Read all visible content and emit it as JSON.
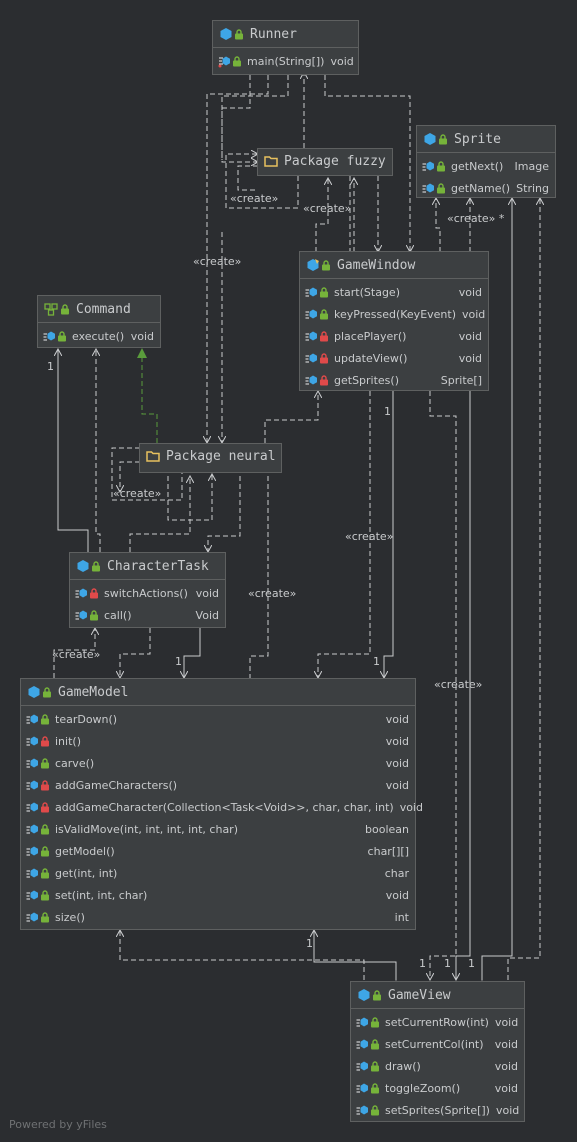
{
  "diagram": {
    "footer": "Powered by yFiles",
    "nodes": {
      "runner": {
        "title": "Runner",
        "kind": "class",
        "members": [
          {
            "name": "main(String[])",
            "type": "void",
            "access": "public",
            "static": true
          }
        ]
      },
      "sprite": {
        "title": "Sprite",
        "kind": "interface",
        "members": [
          {
            "name": "getNext()",
            "type": "Image",
            "access": "public"
          },
          {
            "name": "getName()",
            "type": "String",
            "access": "public"
          }
        ]
      },
      "fuzzy": {
        "title": "Package fuzzy",
        "kind": "package"
      },
      "gamewindow": {
        "title": "GameWindow",
        "kind": "class",
        "members": [
          {
            "name": "start(Stage)",
            "type": "void",
            "access": "public"
          },
          {
            "name": "keyPressed(KeyEvent)",
            "type": "void",
            "access": "public"
          },
          {
            "name": "placePlayer()",
            "type": "void",
            "access": "private"
          },
          {
            "name": "updateView()",
            "type": "void",
            "access": "private"
          },
          {
            "name": "getSprites()",
            "type": "Sprite[]",
            "access": "private"
          }
        ]
      },
      "command": {
        "title": "Command",
        "kind": "interface",
        "members": [
          {
            "name": "execute()",
            "type": "void",
            "access": "public"
          }
        ]
      },
      "neural": {
        "title": "Package neural",
        "kind": "package"
      },
      "charactertask": {
        "title": "CharacterTask",
        "kind": "class",
        "members": [
          {
            "name": "switchActions()",
            "type": "void",
            "access": "private"
          },
          {
            "name": "call()",
            "type": "Void",
            "access": "public"
          }
        ]
      },
      "gamemodel": {
        "title": "GameModel",
        "kind": "class",
        "members": [
          {
            "name": "tearDown()",
            "type": "void",
            "access": "public"
          },
          {
            "name": "init()",
            "type": "void",
            "access": "private"
          },
          {
            "name": "carve()",
            "type": "void",
            "access": "public"
          },
          {
            "name": "addGameCharacters()",
            "type": "void",
            "access": "private"
          },
          {
            "name": "addGameCharacter(Collection<Task<Void>>, char, char, int)",
            "type": "void",
            "access": "private"
          },
          {
            "name": "isValidMove(int, int, int, int, char)",
            "type": "boolean",
            "access": "public"
          },
          {
            "name": "getModel()",
            "type": "char[][]",
            "access": "public"
          },
          {
            "name": "get(int, int)",
            "type": "char",
            "access": "public"
          },
          {
            "name": "set(int, int, char)",
            "type": "void",
            "access": "public"
          },
          {
            "name": "size()",
            "type": "int",
            "access": "public"
          }
        ]
      },
      "gameview": {
        "title": "GameView",
        "kind": "class",
        "members": [
          {
            "name": "setCurrentRow(int)",
            "type": "void",
            "access": "public"
          },
          {
            "name": "setCurrentCol(int)",
            "type": "void",
            "access": "public"
          },
          {
            "name": "draw()",
            "type": "void",
            "access": "public"
          },
          {
            "name": "toggleZoom()",
            "type": "void",
            "access": "public"
          },
          {
            "name": "setSprites(Sprite[])",
            "type": "void",
            "access": "public"
          }
        ]
      }
    },
    "labels": {
      "create": "«create»",
      "create_many": "«create» *",
      "one": "1"
    },
    "colors": {
      "background": "#2b2d30",
      "node_fill": "#3c3f41",
      "edge": "#c9cbcd",
      "class_icon": "#3ea6e6",
      "lock_public": "#76b33a",
      "lock_private": "#e04a4a",
      "package_icon": "#e7c15f",
      "inheritance": "#5a9c3c"
    }
  }
}
